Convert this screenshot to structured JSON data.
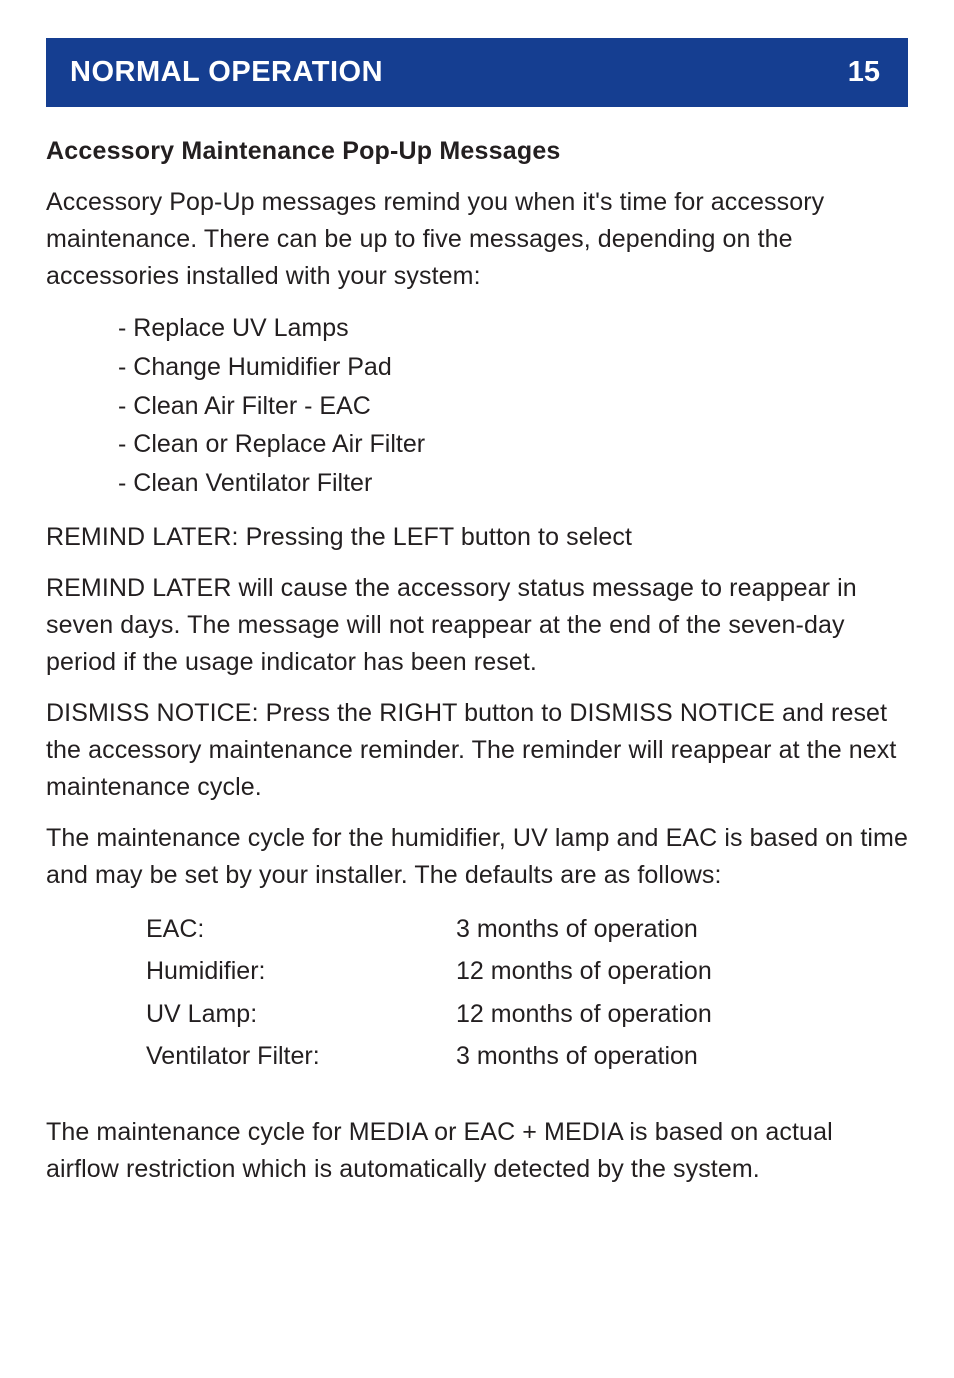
{
  "header": {
    "title": "NORMAL OPERATION",
    "page": "15"
  },
  "subheading": "Accessory Maintenance Pop-Up Messages",
  "intro": "Accessory Pop-Up messages remind you when it's time for accessory maintenance. There can be up to five messages, depending on the accessories installed with your system:",
  "messages": [
    "- Replace UV Lamps",
    "- Change Humidifier Pad",
    "- Clean Air Filter - EAC",
    "- Clean or Replace Air Filter",
    "- Clean Ventilator Filter"
  ],
  "remind_later_title": "REMIND LATER: Pressing the LEFT button to select",
  "remind_later_body": "REMIND LATER will cause the accessory status message to reappear in seven days. The message will not reappear at the end of the seven-day period if the usage indicator has been reset.",
  "dismiss_notice": "DISMISS NOTICE: Press the RIGHT button to DISMISS NOTICE and reset the accessory maintenance reminder. The reminder will reappear at the next maintenance cycle.",
  "defaults_intro": "The maintenance cycle for the humidifier, UV lamp and EAC is based on time and may be set by your installer. The defaults are as follows:",
  "defaults": [
    {
      "label": "EAC:",
      "value": "3 months of operation"
    },
    {
      "label": "Humidifier:",
      "value": "12 months of operation"
    },
    {
      "label": "UV Lamp:",
      "value": "12 months of operation"
    },
    {
      "label": "Ventilator Filter:",
      "value": "3 months of operation"
    }
  ],
  "media_note": "The maintenance cycle for MEDIA or EAC + MEDIA is based on actual airflow restriction which is automatically detected by the system."
}
